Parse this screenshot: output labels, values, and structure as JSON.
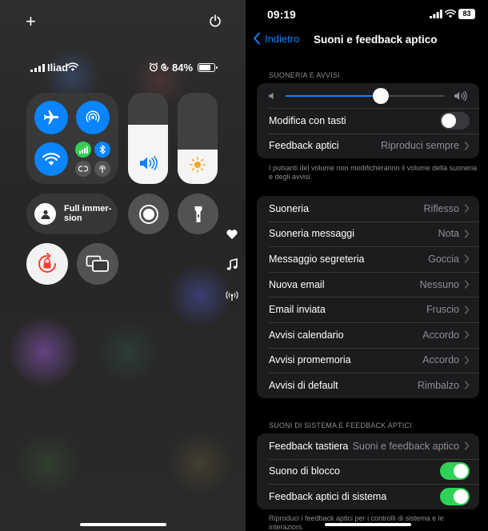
{
  "control_center": {
    "carrier": "Iliad",
    "battery_percent": "84%",
    "battery_level": 0.84,
    "focus_label": "Full immer-sion",
    "volume_level": 0.65,
    "brightness_level": 0.38,
    "icons": [
      "add-icon",
      "power-icon",
      "airplane-mode-icon",
      "airdrop-icon",
      "wifi-icon",
      "cellular-data-icon",
      "bluetooth-icon",
      "vpn-icon",
      "hotspot-icon",
      "volume-icon",
      "brightness-icon",
      "focus-avatar-icon",
      "screen-record-icon",
      "flashlight-icon",
      "rotation-lock-icon",
      "screen-mirroring-icon",
      "heart-icon",
      "music-note-icon",
      "radio-icon"
    ],
    "accent_blue": "#0a84ff",
    "accent_green": "#30d158"
  },
  "status": {
    "time": "09:19",
    "battery": "83"
  },
  "nav": {
    "back_label": "Indietro",
    "title": "Suoni e feedback aptico"
  },
  "section1": {
    "header": "SUONERIA E AVVISI",
    "volume_level": 0.6,
    "rows": [
      {
        "label": "Modifica con tasti",
        "toggle": false
      },
      {
        "label": "Feedback aptici",
        "value": "Riproduci sempre"
      }
    ],
    "footnote": "I pulsanti del volume non modificheranno il volume della suoneria e degli avvisi."
  },
  "section2": {
    "rows": [
      {
        "label": "Suoneria",
        "value": "Riflesso"
      },
      {
        "label": "Suoneria messaggi",
        "value": "Nota"
      },
      {
        "label": "Messaggio segreteria",
        "value": "Goccia"
      },
      {
        "label": "Nuova email",
        "value": "Nessuno"
      },
      {
        "label": "Email inviata",
        "value": "Fruscio"
      },
      {
        "label": "Avvisi calendario",
        "value": "Accordo"
      },
      {
        "label": "Avvisi promemoria",
        "value": "Accordo"
      },
      {
        "label": "Avvisi di default",
        "value": "Rimbalzo"
      }
    ]
  },
  "section3": {
    "header": "SUONI DI SISTEMA E FEEDBACK APTICI",
    "rows": [
      {
        "label": "Feedback tastiera",
        "value": "Suoni e feedback aptico"
      },
      {
        "label": "Suono di blocco",
        "toggle": true
      },
      {
        "label": "Feedback aptici di sistema",
        "toggle": true
      }
    ],
    "footnote": "Riproduci i feedback aptici per i controlli di sistema e le interazioni."
  }
}
